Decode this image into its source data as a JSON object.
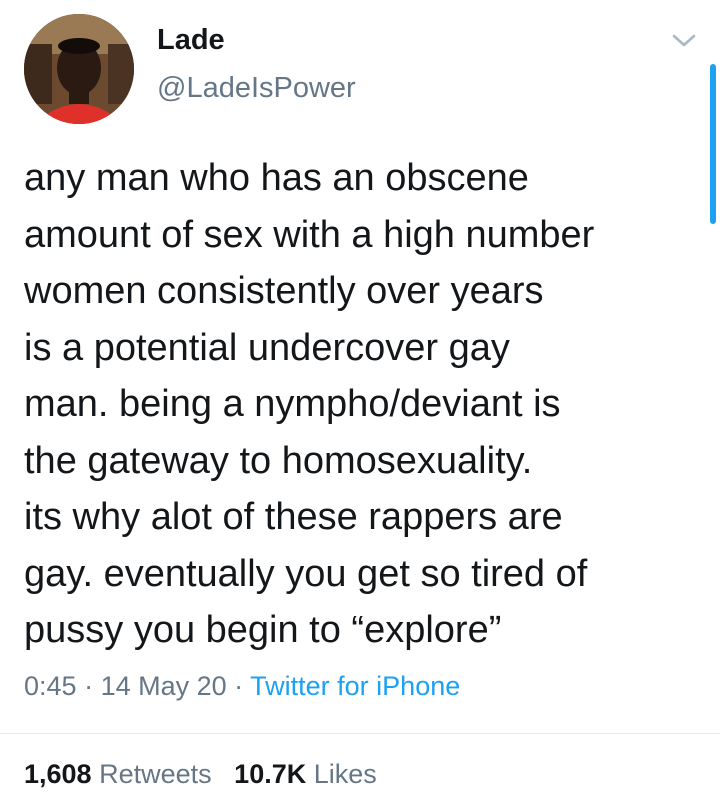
{
  "user": {
    "display_name": "Lade",
    "handle": "@LadeIsPower"
  },
  "tweet": {
    "text": "any man who has an obscene\namount of sex with a high number\nwomen consistently over years\nis a potential undercover gay\nman. being a nympho/deviant is\nthe gateway to homosexuality.\nits why alot of these rappers are\ngay. eventually you get so tired of\npussy you begin to “explore”"
  },
  "meta": {
    "time": "0:45",
    "separator": " · ",
    "date": "14 May 20",
    "source": "Twitter for iPhone"
  },
  "stats": {
    "retweets_count": "1,608",
    "retweets_label": "Retweets",
    "likes_count": "10.7K",
    "likes_label": "Likes"
  },
  "icons": {
    "menu": "chevron-down-icon",
    "avatar": "profile-photo"
  },
  "colors": {
    "text": "#14171a",
    "secondary": "#657786",
    "link": "#1da1f2"
  }
}
